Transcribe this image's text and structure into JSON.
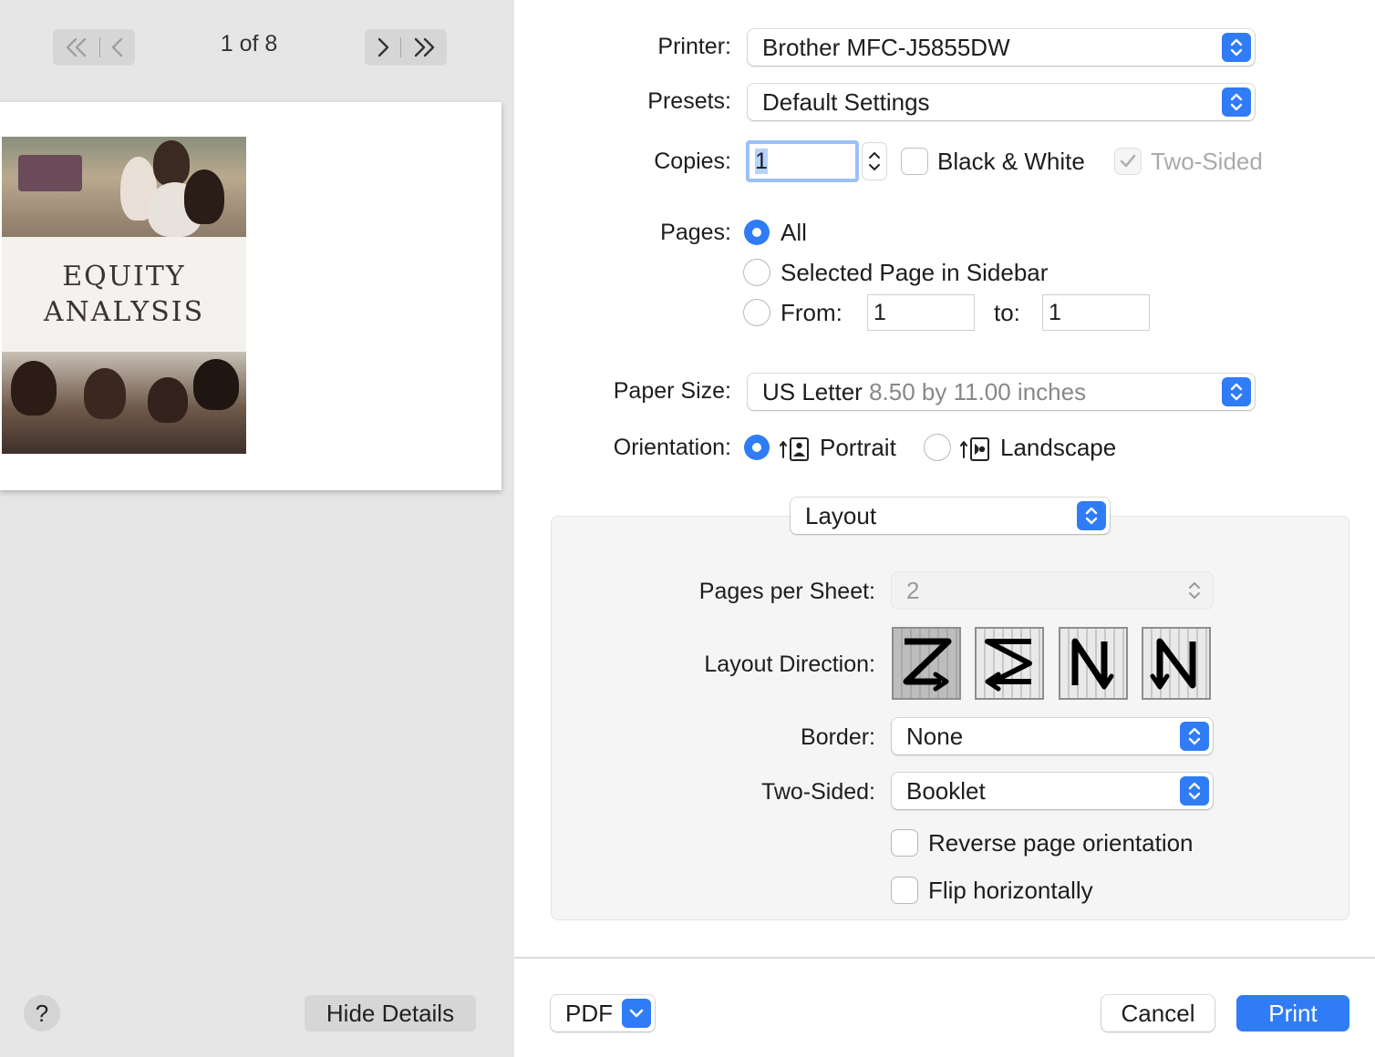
{
  "preview": {
    "page_indicator": "1 of 8",
    "cover_title_line1": "EQUITY",
    "cover_title_line2": "ANALYSIS"
  },
  "sidebar_buttons": {
    "help": "?",
    "hide_details": "Hide Details"
  },
  "printer": {
    "label": "Printer:",
    "value": "Brother MFC-J5855DW"
  },
  "presets": {
    "label": "Presets:",
    "value": "Default Settings"
  },
  "copies": {
    "label": "Copies:",
    "value": "1",
    "black_white_label": "Black & White",
    "black_white_checked": false,
    "two_sided_label": "Two-Sided",
    "two_sided_checked": true,
    "two_sided_enabled": false
  },
  "pages": {
    "label": "Pages:",
    "options": {
      "all": "All",
      "selected": "Selected Page in Sidebar",
      "from": "From:"
    },
    "selected_option": "All",
    "from_value": "1",
    "to_label": "to:",
    "to_value": "1"
  },
  "paper_size": {
    "label": "Paper Size:",
    "value": "US Letter",
    "detail": "8.50 by 11.00 inches"
  },
  "orientation": {
    "label": "Orientation:",
    "portrait": "Portrait",
    "landscape": "Landscape",
    "selected": "Portrait"
  },
  "section_menu": {
    "value": "Layout"
  },
  "layout": {
    "pages_per_sheet_label": "Pages per Sheet:",
    "pages_per_sheet_value": "2",
    "direction_label": "Layout Direction:",
    "direction_icons": [
      "z-icon",
      "reverse-z-icon",
      "reverse-n-icon",
      "n-icon"
    ],
    "direction_selected": 0,
    "border_label": "Border:",
    "border_value": "None",
    "two_sided_label": "Two-Sided:",
    "two_sided_value": "Booklet",
    "reverse_label": "Reverse page orientation",
    "flip_label": "Flip horizontally"
  },
  "footer": {
    "pdf": "PDF",
    "cancel": "Cancel",
    "print": "Print"
  },
  "colors": {
    "accent": "#2f7cf6",
    "sidebar_bg": "#e6e6e6"
  }
}
